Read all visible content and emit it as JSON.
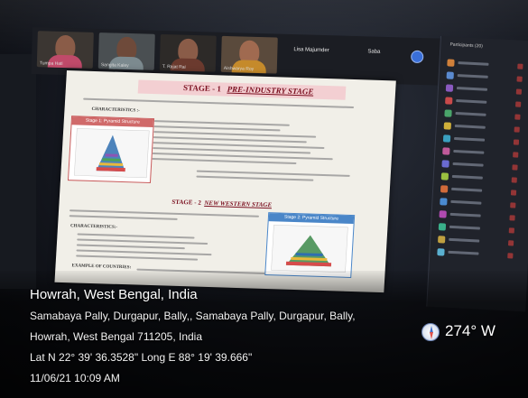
{
  "meeting": {
    "participant_tiles": [
      {
        "name": "Tumpa Hati",
        "shirt": "#c04a6a"
      },
      {
        "name": "Sangita Kaley",
        "shirt": "#7c8a8f"
      },
      {
        "name": "T. Rajat Rai",
        "shirt": "#6b3a2e"
      },
      {
        "name": "Aishwarya Roy",
        "shirt": "#c58a2b"
      }
    ],
    "name_boxes": [
      "Lisa Majumder",
      "Saba"
    ],
    "panel_header": "Participants (20)"
  },
  "slide": {
    "title_prefix": "STAGE - 1",
    "title_main": "PRE-INDUSTRY STAGE",
    "characteristics": "CHARACTERISTICS :-",
    "pyramid1_label": "Stage 1: Pyramid Structure",
    "stage2_prefix": "STAGE - 2",
    "stage2_main": "NEW WESTERN STAGE",
    "pyramid2_label": "Stage 2: Pyramid Structure",
    "characteristics2": "CHARACTERISTICS:-",
    "examples": "EXAMPLE OF COUNTRIES:"
  },
  "geotag": {
    "location_title": "Howrah, West Bengal, India",
    "address_line1": "Samabaya Pally, Durgapur, Bally,, Samabaya Pally, Durgapur, Bally,",
    "address_line2": "Howrah, West Bengal 711205, India",
    "coordinates": "Lat N 22° 39' 36.3528\" Long E 88° 19' 39.666\"",
    "datetime": "11/06/21 10:09 AM",
    "heading": "274° W"
  },
  "colors": {
    "slide_title_bg": "#f3cfd2",
    "slide_title_text": "#7b1020",
    "pyramid_box_border": "#c85a5a",
    "stage2_box_border": "#4a86c8",
    "compass_accent": "#3f6fc7"
  },
  "icons": [
    "compass-icon",
    "participants-list-icon"
  ]
}
